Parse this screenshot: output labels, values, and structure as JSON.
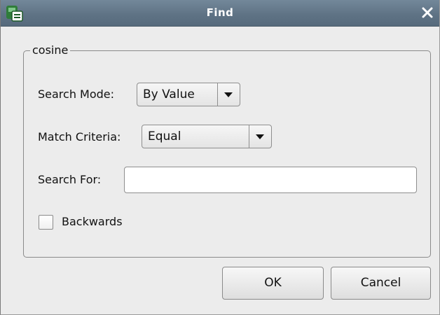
{
  "window": {
    "title": "Find"
  },
  "group": {
    "legend": "cosine"
  },
  "search_mode": {
    "label": "Search Mode:",
    "value": "By Value"
  },
  "match_criteria": {
    "label": "Match Criteria:",
    "value": "Equal"
  },
  "search_for": {
    "label": "Search For:",
    "value": ""
  },
  "backwards": {
    "label": "Backwards",
    "checked": false
  },
  "buttons": {
    "ok": "OK",
    "cancel": "Cancel"
  },
  "icons": {
    "app": "app-icon",
    "close": "close-icon",
    "dropdown": "chevron-down-icon"
  }
}
